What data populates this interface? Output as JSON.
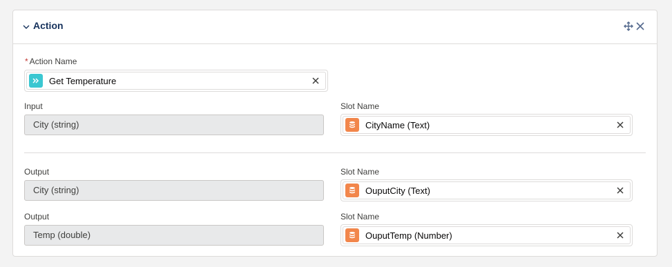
{
  "card": {
    "title": "Action"
  },
  "action_name": {
    "label": "Action Name",
    "required_marker": "*",
    "value": "Get Temperature"
  },
  "mappings": [
    {
      "left_label": "Input",
      "left_value": "City (string)",
      "right_label": "Slot Name",
      "right_value": "CityName (Text)"
    },
    {
      "left_label": "Output",
      "left_value": "City (string)",
      "right_label": "Slot Name",
      "right_value": "OuputCity (Text)"
    },
    {
      "left_label": "Output",
      "left_value": "Temp (double)",
      "right_label": "Slot Name",
      "right_value": "OuputTemp (Number)"
    }
  ],
  "colors": {
    "action_icon": "#3bc7d1",
    "slot_icon": "#f2864b",
    "title": "#16325c",
    "readonly_bg": "#e8e9ea"
  },
  "icons": [
    "chevron-down-icon",
    "move-icon",
    "close-icon",
    "action-icon",
    "database-icon",
    "clear-icon"
  ]
}
